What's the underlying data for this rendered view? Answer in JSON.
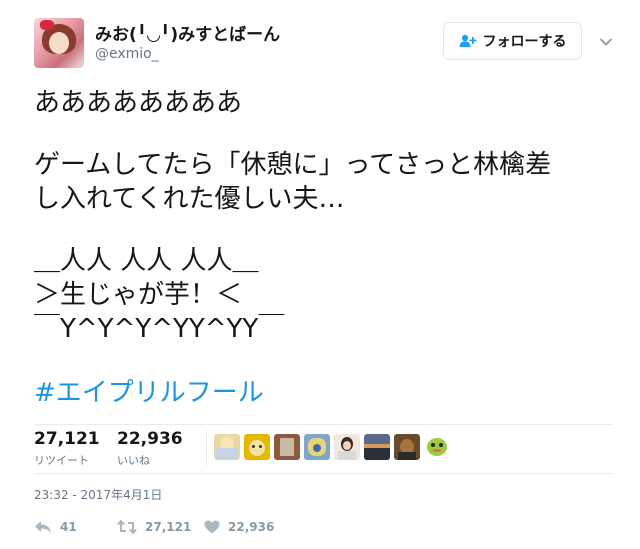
{
  "user": {
    "display_name": "みお(╹◡╹)みすとばーん",
    "handle": "@exmio_",
    "avatar_icon": "user-avatar"
  },
  "follow_button": {
    "label": "フォローする",
    "icon": "person-add-icon"
  },
  "menu_icon": "chevron-down-icon",
  "tweet": {
    "lines": [
      "ああああああああ",
      "ゲームしてたら「休憩に」ってさっと林檎差",
      "し入れてくれた優しい夫…",
      "＿人人 人人 人人＿",
      "＞生じゃが芋！＜",
      "￣Y^Y^Y^YY^YY￣"
    ],
    "hashtag": "#エイプリルフール"
  },
  "stats": {
    "retweets": {
      "count": "27,121",
      "label": "リツイート"
    },
    "likes": {
      "count": "22,936",
      "label": "いいね"
    }
  },
  "likers": [
    {
      "name": "liker-avatar-1",
      "color": "#e9d9a0"
    },
    {
      "name": "liker-avatar-2",
      "color": "#e6b800"
    },
    {
      "name": "liker-avatar-3",
      "color": "#8c5a3c"
    },
    {
      "name": "liker-avatar-4",
      "color": "#7ea6c8"
    },
    {
      "name": "liker-avatar-5",
      "color": "#f1e6e0"
    },
    {
      "name": "liker-avatar-6",
      "color": "#5b6a8a"
    },
    {
      "name": "liker-avatar-7",
      "color": "#6b4a2a"
    },
    {
      "name": "liker-avatar-8",
      "color": "#9ccc3a"
    }
  ],
  "timestamp": "23:32 - 2017年4月1日",
  "actions": {
    "reply": {
      "icon": "reply-icon",
      "count": "41"
    },
    "retweet": {
      "icon": "retweet-icon",
      "count": "27,121"
    },
    "like": {
      "icon": "heart-icon",
      "count": "22,936"
    }
  },
  "colors": {
    "link": "#1b95e0",
    "muted": "#657786",
    "action": "#8899a6",
    "border": "#e6ecf0"
  }
}
